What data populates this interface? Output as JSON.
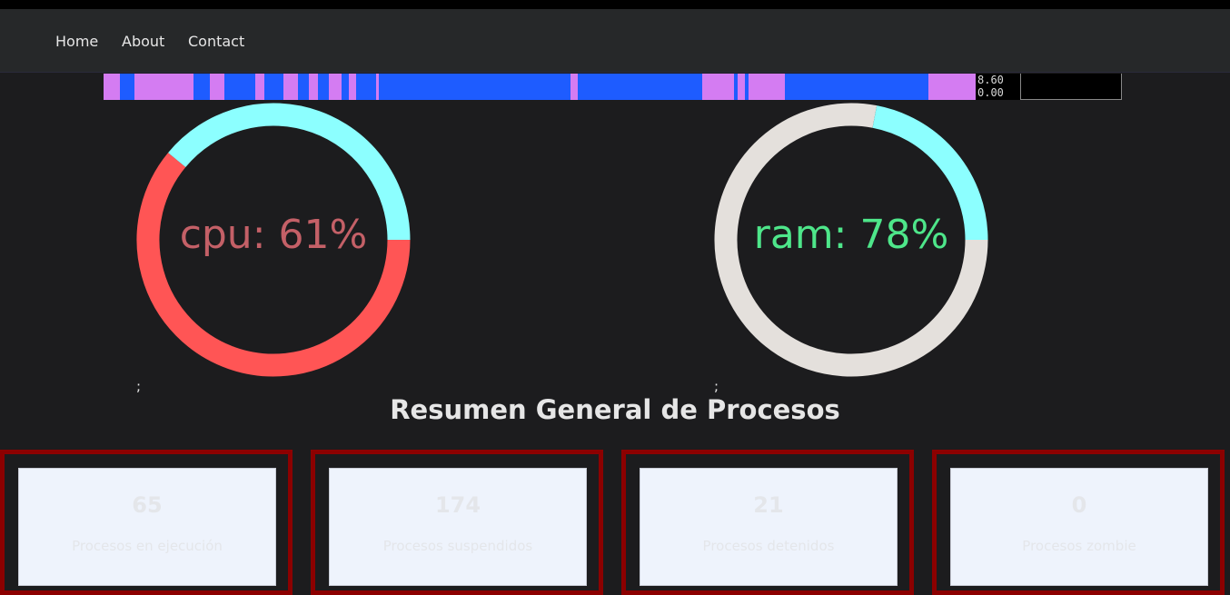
{
  "nav": {
    "items": [
      "Home",
      "About",
      "Contact"
    ]
  },
  "strip": {
    "scale_top": "8.60",
    "scale_bottom": "0.00",
    "colors": {
      "a": "#d47cf2",
      "b": "#1e5cff"
    },
    "segments": [
      [
        "a",
        0.018
      ],
      [
        "b",
        0.016
      ],
      [
        "a",
        0.066
      ],
      [
        "b",
        0.018
      ],
      [
        "a",
        0.016
      ],
      [
        "b",
        0.034
      ],
      [
        "a",
        0.01
      ],
      [
        "b",
        0.022
      ],
      [
        "a",
        0.016
      ],
      [
        "b",
        0.012
      ],
      [
        "a",
        0.01
      ],
      [
        "b",
        0.012
      ],
      [
        "a",
        0.014
      ],
      [
        "b",
        0.008
      ],
      [
        "a",
        0.008
      ],
      [
        "b",
        0.022
      ],
      [
        "a",
        0.004
      ],
      [
        "b",
        0.212
      ],
      [
        "a",
        0.008
      ],
      [
        "b",
        0.138
      ],
      [
        "a",
        0.036
      ],
      [
        "b",
        0.004
      ],
      [
        "a",
        0.008
      ],
      [
        "b",
        0.004
      ],
      [
        "a",
        0.04
      ],
      [
        "b",
        0.16
      ],
      [
        "a",
        0.052
      ]
    ]
  },
  "cpu": {
    "label": "cpu: 61%",
    "percent": 61,
    "used_color": "#ff5555",
    "free_color": "#8cffff",
    "label_color": "#c46067"
  },
  "ram": {
    "label": "ram: 78%",
    "percent": 78,
    "used_color": "#e4e0dc",
    "free_color": "#8cffff",
    "label_color": "#4ee68a"
  },
  "cpu_trailing": ";",
  "ram_trailing": ";",
  "summary": {
    "title": "Resumen General de Procesos",
    "cards": [
      {
        "count": "65",
        "label": "Procesos en ejecución"
      },
      {
        "count": "174",
        "label": "Procesos suspendidos"
      },
      {
        "count": "21",
        "label": "Procesos detenidos"
      },
      {
        "count": "0",
        "label": "Procesos zombie"
      }
    ]
  }
}
